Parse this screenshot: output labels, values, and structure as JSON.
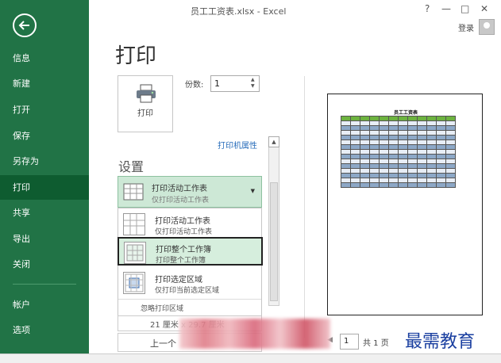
{
  "window": {
    "title": "员工工资表.xlsx - Excel",
    "help": "?",
    "minimize": "—",
    "restore": "□",
    "close": "✕",
    "login": "登录"
  },
  "sidebar": {
    "items": [
      {
        "label": "信息"
      },
      {
        "label": "新建"
      },
      {
        "label": "打开"
      },
      {
        "label": "保存"
      },
      {
        "label": "另存为"
      },
      {
        "label": "打印",
        "active": true
      },
      {
        "label": "共享"
      },
      {
        "label": "导出"
      },
      {
        "label": "关闭"
      },
      {
        "label": "帐户"
      },
      {
        "label": "选项"
      }
    ]
  },
  "print": {
    "heading": "打印",
    "print_button": "打印",
    "copies_label": "份数:",
    "copies_value": "1",
    "printer_props": "打印机属性",
    "settings_heading": "设置",
    "selected": {
      "line1": "打印活动工作表",
      "line2": "仅打印活动工作表"
    },
    "options": [
      {
        "line1": "打印活动工作表",
        "line2": "仅打印活动工作表"
      },
      {
        "line1": "打印整个工作簿",
        "line2": "打印整个工作簿"
      },
      {
        "line1": "打印选定区域",
        "line2": "仅打印当前选定区域"
      }
    ],
    "ignore_area": "忽略打印区域",
    "paper": "21 厘米 x 29.7 厘米",
    "prev_label": "上一个"
  },
  "preview": {
    "sheet_title": "员工工资表",
    "page_value": "1",
    "page_total": "共 1 页",
    "prev_arrow": "◀"
  },
  "watermark": "最需教育",
  "colors": {
    "accent": "#217346",
    "selection": "#cde8d6",
    "table_header": "#6db33f"
  }
}
